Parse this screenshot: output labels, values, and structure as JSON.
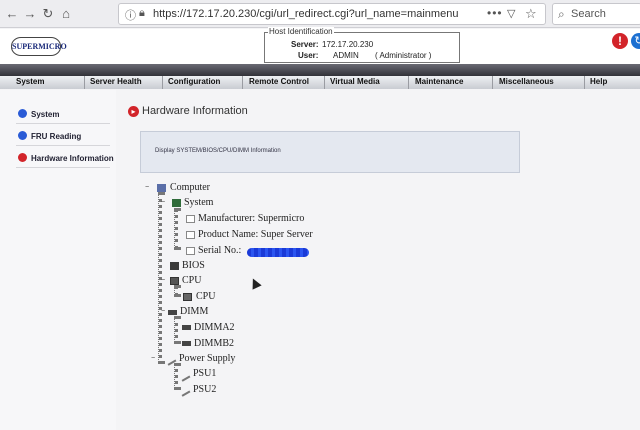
{
  "browser": {
    "url": "https://172.17.20.230/cgi/url_redirect.cgi?url_name=mainmenu",
    "search_placeholder": "Search",
    "icons": [
      "back-icon",
      "forward-icon",
      "reload-icon",
      "home-icon",
      "info-icon",
      "lock-icon",
      "more-icon",
      "pocket-icon",
      "star-icon",
      "search-icon"
    ]
  },
  "header": {
    "logo_text": "SUPERMICRO",
    "host_legend": "Host Identification",
    "server_label": "Server:",
    "server_value": "172.17.20.230",
    "user_label": "User:",
    "user_value": "ADMIN",
    "role_value": "( Administrator )"
  },
  "menu": {
    "items": [
      "System",
      "Server Health",
      "Configuration",
      "Remote Control",
      "Virtual Media",
      "Maintenance",
      "Miscellaneous",
      "Help"
    ]
  },
  "sidebar": {
    "items": [
      {
        "label": "System",
        "color": "#2a5bd6"
      },
      {
        "label": "FRU Reading",
        "color": "#2a5bd6"
      },
      {
        "label": "Hardware Information",
        "color": "#d2242a"
      }
    ]
  },
  "main": {
    "title": "Hardware Information",
    "description": "Display SYSTEM/BIOS/CPU/DIMM Information"
  },
  "tree": {
    "computer": "Computer",
    "system": "System",
    "manufacturer": "Manufacturer: Supermicro",
    "product": "Product Name: Super Server",
    "serial": "Serial No.:",
    "bios": "BIOS",
    "cpu_group": "CPU",
    "cpu": "CPU",
    "dimm_group": "DIMM",
    "dimma2": "DIMMA2",
    "dimmb2": "DIMMB2",
    "power_supply": "Power Supply",
    "psu1": "PSU1",
    "psu2": "PSU2"
  },
  "colors": {
    "accent_red": "#d2242a",
    "accent_blue": "#2a5bd6",
    "menu_dark": "#2a2a30"
  }
}
